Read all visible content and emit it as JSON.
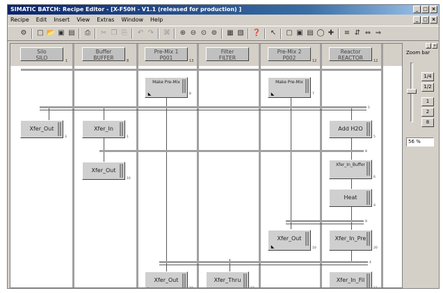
{
  "window": {
    "title": "SIMATIC BATCH: Recipe Editor - [X-F50H - V1.1 (released for production) ]",
    "caption_buttons": [
      "_",
      "□",
      "×"
    ]
  },
  "menu": [
    "Recipe",
    "Edit",
    "Insert",
    "View",
    "Extras",
    "Window",
    "Help"
  ],
  "toolbar_icons": [
    "tool-icon",
    "new-icon",
    "open-icon",
    "save-icon",
    "print-icon",
    "cut-icon",
    "copy-icon",
    "paste-icon",
    "undo-icon",
    "redo-icon",
    "find-icon",
    "zoom-in-icon",
    "zoom-out-icon",
    "zoom-fit-icon",
    "zoom-area-icon",
    "properties-icon",
    "layout-icon",
    "help-icon",
    "pointer-icon",
    "insert-step-icon",
    "insert-transition-icon",
    "insert-sync-icon",
    "insert-loop-icon",
    "insert-branch-icon",
    "align-icon",
    "merge-icon",
    "split-icon",
    "arrow-icon"
  ],
  "units": [
    {
      "line1": "Silo",
      "line2": "SILO",
      "mark": "1"
    },
    {
      "line1": "Buffer",
      "line2": "BUFFER",
      "mark": "8"
    },
    {
      "line1": "Pre-Mix 1",
      "line2": "P001",
      "mark": "13"
    },
    {
      "line1": "Filter",
      "line2": "FILTER",
      "mark": ""
    },
    {
      "line1": "Pre-Mix 2",
      "line2": "P002",
      "mark": "12"
    },
    {
      "line1": "Reactor",
      "line2": "REACTOR",
      "mark": "12"
    }
  ],
  "steps": {
    "make_premix_1": {
      "label": "Make Pre-Mix",
      "tag": "8"
    },
    "make_premix_2": {
      "label": "Make Pre-Mix",
      "tag": "7"
    },
    "xfer_out_silo": {
      "label": "Xfer_Out",
      "tag": "3"
    },
    "xfer_in_buffer": {
      "label": "Xfer_In",
      "tag": "1"
    },
    "add_h2o": {
      "label": "Add H2O",
      "tag": "5"
    },
    "xfer_out_buffer": {
      "label": "Xfer_Out",
      "tag": "10"
    },
    "xfer_in_buffer_r": {
      "label": "Xfer_In_Buffer",
      "tag": "6"
    },
    "heat": {
      "label": "Heat",
      "tag": "9"
    },
    "xfer_out_p2": {
      "label": "Xfer_Out",
      "tag": "10"
    },
    "xfer_in_pre": {
      "label": "Xfer_In_Pre",
      "tag": "20"
    },
    "xfer_out_p1": {
      "label": "Xfer_Out",
      "tag": "10"
    },
    "xfer_thru": {
      "label": "Xfer_Thru",
      "tag": "10"
    },
    "xfer_in_fil": {
      "label": "Xfer_In_Fil",
      "tag": "11"
    }
  },
  "sync_marks": [
    "1",
    "8",
    "9",
    "4"
  ],
  "zoom": {
    "title": "Zoom bar",
    "buttons": [
      "1/4",
      "1/2",
      "1",
      "2",
      "8"
    ],
    "value": "56 %"
  }
}
